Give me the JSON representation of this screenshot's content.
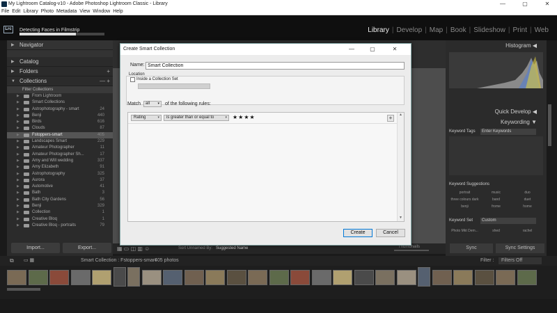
{
  "window": {
    "title": "My Lightroom Catalog-v10 - Adobe Photoshop Lightroom Classic - Library",
    "min": "—",
    "max": "▢",
    "close": "✕"
  },
  "menu": [
    "File",
    "Edit",
    "Library",
    "Photo",
    "Metadata",
    "View",
    "Window",
    "Help"
  ],
  "identity": {
    "logo": "Lrc",
    "status": "Detecting Faces in Filmstrip",
    "progress": 0.66
  },
  "modules": [
    {
      "label": "Library",
      "active": true
    },
    {
      "label": "Develop"
    },
    {
      "label": "Map"
    },
    {
      "label": "Book"
    },
    {
      "label": "Slideshow"
    },
    {
      "label": "Print"
    },
    {
      "label": "Web"
    }
  ],
  "left_panel": {
    "navigator": "Navigator",
    "catalog": "Catalog",
    "folders": "Folders",
    "collections": "Collections",
    "filter": "Filter Collections",
    "items": [
      {
        "label": "From Lightroom",
        "count": ""
      },
      {
        "label": "Smart Collections",
        "count": ""
      },
      {
        "label": "Astrophotography - smart",
        "count": "24"
      },
      {
        "label": "Benji",
        "count": "440"
      },
      {
        "label": "Birds",
        "count": "616"
      },
      {
        "label": "Clouds",
        "count": "87"
      },
      {
        "label": "Fstoppers-smart",
        "count": "405",
        "selected": true
      },
      {
        "label": "Landscapes Smart",
        "count": "229"
      },
      {
        "label": "Amateur Photographer",
        "count": "11"
      },
      {
        "label": "Amateur Photographer Sh...",
        "count": "17"
      },
      {
        "label": "Amy and Will wedding",
        "count": "337"
      },
      {
        "label": "Amy Elizabeth",
        "count": "91"
      },
      {
        "label": "Astrophotography",
        "count": "325"
      },
      {
        "label": "Aurora",
        "count": "37"
      },
      {
        "label": "Automotive",
        "count": "41"
      },
      {
        "label": "Bath",
        "count": "3"
      },
      {
        "label": "Bath City Gardens",
        "count": "56"
      },
      {
        "label": "Benji",
        "count": "329"
      },
      {
        "label": "Collection",
        "count": "1"
      },
      {
        "label": "Creative Bloq",
        "count": "1"
      },
      {
        "label": "Creative Bloq - portraits",
        "count": "79"
      }
    ],
    "import": "Import...",
    "export": "Export..."
  },
  "toolbar": {
    "sort": "Sort Unnamed By:",
    "sort_value": "Suggested Name",
    "thumbs": "Thumbnails"
  },
  "right_panel": {
    "histogram": "Histogram",
    "quick_develop": "Quick Develop",
    "keywording": "Keywording",
    "keyword_tags_label": "Keyword Tags",
    "keyword_tags_value": "Enter Keywords",
    "keyword_suggestions": "Keyword Suggestions",
    "suggestions": [
      "portrait",
      "music",
      "duo",
      "three colours dark",
      "band",
      "duet",
      "benji",
      "frome",
      "home"
    ],
    "keyword_set_label": "Keyword Set",
    "keyword_set_value": "Custom",
    "set_items": [
      "Photo Mkt Dem...",
      "shed",
      "rachel"
    ],
    "sync": "Sync",
    "sync_settings": "Sync Settings"
  },
  "filmstrip": {
    "breadcrumb": "Smart Collection : Fstoppers-smart",
    "count": "405 photos",
    "filter_label": "Filter :",
    "filter_value": "Filters Off"
  },
  "dialog": {
    "title": "Create Smart Collection",
    "name_label": "Name:",
    "name_value": "Smart Collection",
    "location_label": "Location",
    "inside_set": "Inside a Collection Set",
    "match_label": "Match",
    "match_value": "all",
    "match_suffix": "of the following rules:",
    "rule_field": "Rating",
    "rule_operator": "is greater than or equal to",
    "rule_stars": "★★★★",
    "add_rule": "+",
    "create": "Create",
    "cancel": "Cancel"
  }
}
